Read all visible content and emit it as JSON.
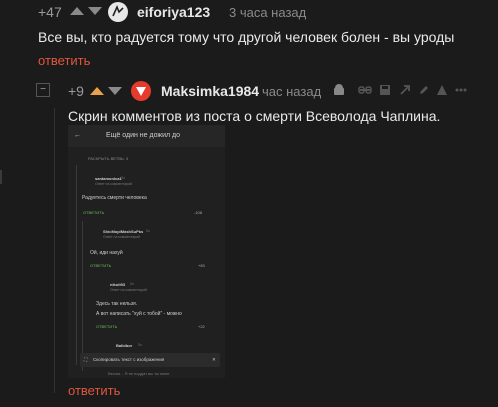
{
  "comment1": {
    "score": "+47",
    "author": "eiforiya123",
    "time": "3 часа назад",
    "text": "Все вы, кто радуется тому что другой человек болен - вы уроды",
    "reply_label": "ответить"
  },
  "comment2": {
    "score": "+9",
    "author": "Maksimka1984",
    "time": "час назад",
    "text": "Скрин комментов из поста о смерти Всеволода Чаплина.",
    "reply_label": "ответить"
  },
  "collapse_symbol": "−",
  "screenshot": {
    "title": "Ещё один не дожил до",
    "expand_label": "РАСКРЫТЬ ВЕТВЬ: 3",
    "c1_author": "santamonica1",
    "c1_age": "3ч",
    "c1_sub": "Ответ на комментарий",
    "c1_text": "Радуетесь смерти человека",
    "c1_reply": "ОТВЕТИТЬ",
    "c1_score": "-108",
    "c2_author": "ShicMoplMashSuPks",
    "c2_age": "3ч",
    "c2_sub": "Ответ на комментарий",
    "c2_text": "Ой, иди нахуй",
    "c2_reply": "ОТВЕТИТЬ",
    "c2_score": "+83",
    "c3_author": "nikolt93",
    "c3_age": "3ч",
    "c3_sub": "Ответ на комментарий",
    "c3_text1": "Здесь так нельзя.",
    "c3_text2": "А вот написать \"хуй с тобой\" - можно",
    "c3_reply": "ОТВЕТИТЬ",
    "c3_score": "+22",
    "c4_author": "Balbibor",
    "c4_age": "3ч",
    "toast_text": "Скопировать текст с изображения",
    "bottom_text": "Весом. - Я не поддат вы ты мене"
  }
}
